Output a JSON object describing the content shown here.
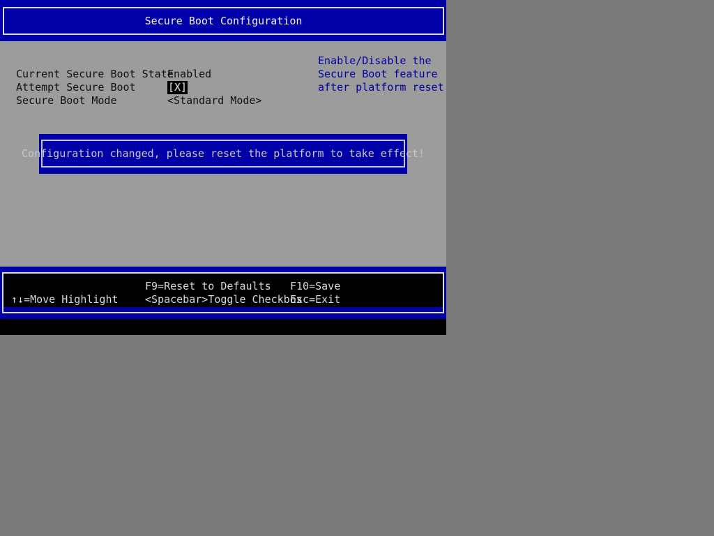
{
  "title": "Secure Boot Configuration",
  "settings": [
    {
      "label": "Current Secure Boot State",
      "value": "Enabled"
    },
    {
      "label": "Attempt Secure Boot",
      "value": "[X]"
    },
    {
      "label": "Secure Boot Mode",
      "value": "<Standard Mode>"
    }
  ],
  "help": [
    "Enable/Disable the",
    "Secure Boot feature",
    "after platform reset"
  ],
  "popup_message": "Configuration changed, please reset the platform to take effect!",
  "footer": {
    "move": "↑↓=Move Highlight",
    "reset": "F9=Reset to Defaults",
    "toggle": "<Spacebar>Toggle Checkbox",
    "save": "F10=Save",
    "exit": "Esc=Exit"
  },
  "colors": {
    "bios_blue": "#0000a8",
    "panel_gray": "#9c9c9c",
    "help_blue": "#0000a0"
  }
}
